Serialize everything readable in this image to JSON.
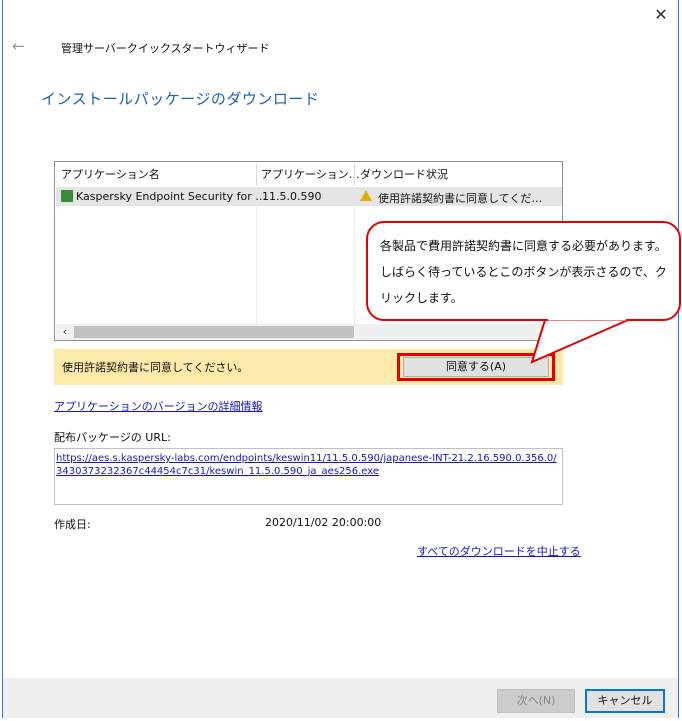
{
  "window": {
    "close_icon": "close-icon",
    "back_icon": "back-arrow-icon",
    "wizard_title": "管理サーバークイックスタートウィザード",
    "page_title": "インストールパッケージのダウンロード"
  },
  "table": {
    "columns": [
      "アプリケーション名",
      "アプリケーション…",
      "ダウンロード状況"
    ],
    "rows": [
      {
        "name": "Kaspersky Endpoint Security for …",
        "version": "11.5.0.590",
        "status": "使用許諾契約書に同意してくだ…",
        "status_icon": "warning-icon"
      }
    ]
  },
  "notice": {
    "text": "使用許諾契約書に同意してください。",
    "agree_button": "同意する(A)"
  },
  "links": {
    "version_details": "アプリケーションのバージョンの詳細情報",
    "cancel_all": "すべてのダウンロードを中止する"
  },
  "package": {
    "url_label": "配布パッケージの URL:",
    "url_line1": "https://aes.s.kaspersky-labs.com/endpoints/keswin11/11.5.0.590/japanese-INT-21.2.16.590.0.356.0/",
    "url_line2": "3430373232367c44454c7c31/keswin_11.5.0.590_ja_aes256.exe",
    "created_label": "作成日:",
    "created_value": "2020/11/02 20:00:00"
  },
  "footer": {
    "next_button": "次へ(N)",
    "cancel_button": "キャンセル"
  },
  "callout": {
    "text": "各製品で費用許諾契約書に同意する必要があります。しばらく待っているとこのボタンが表示さるので、クリックします。"
  },
  "colors": {
    "accent": "#1a5fb4",
    "notice_bg": "#fde9a9",
    "highlight": "#e60000",
    "link": "#1515cc"
  }
}
